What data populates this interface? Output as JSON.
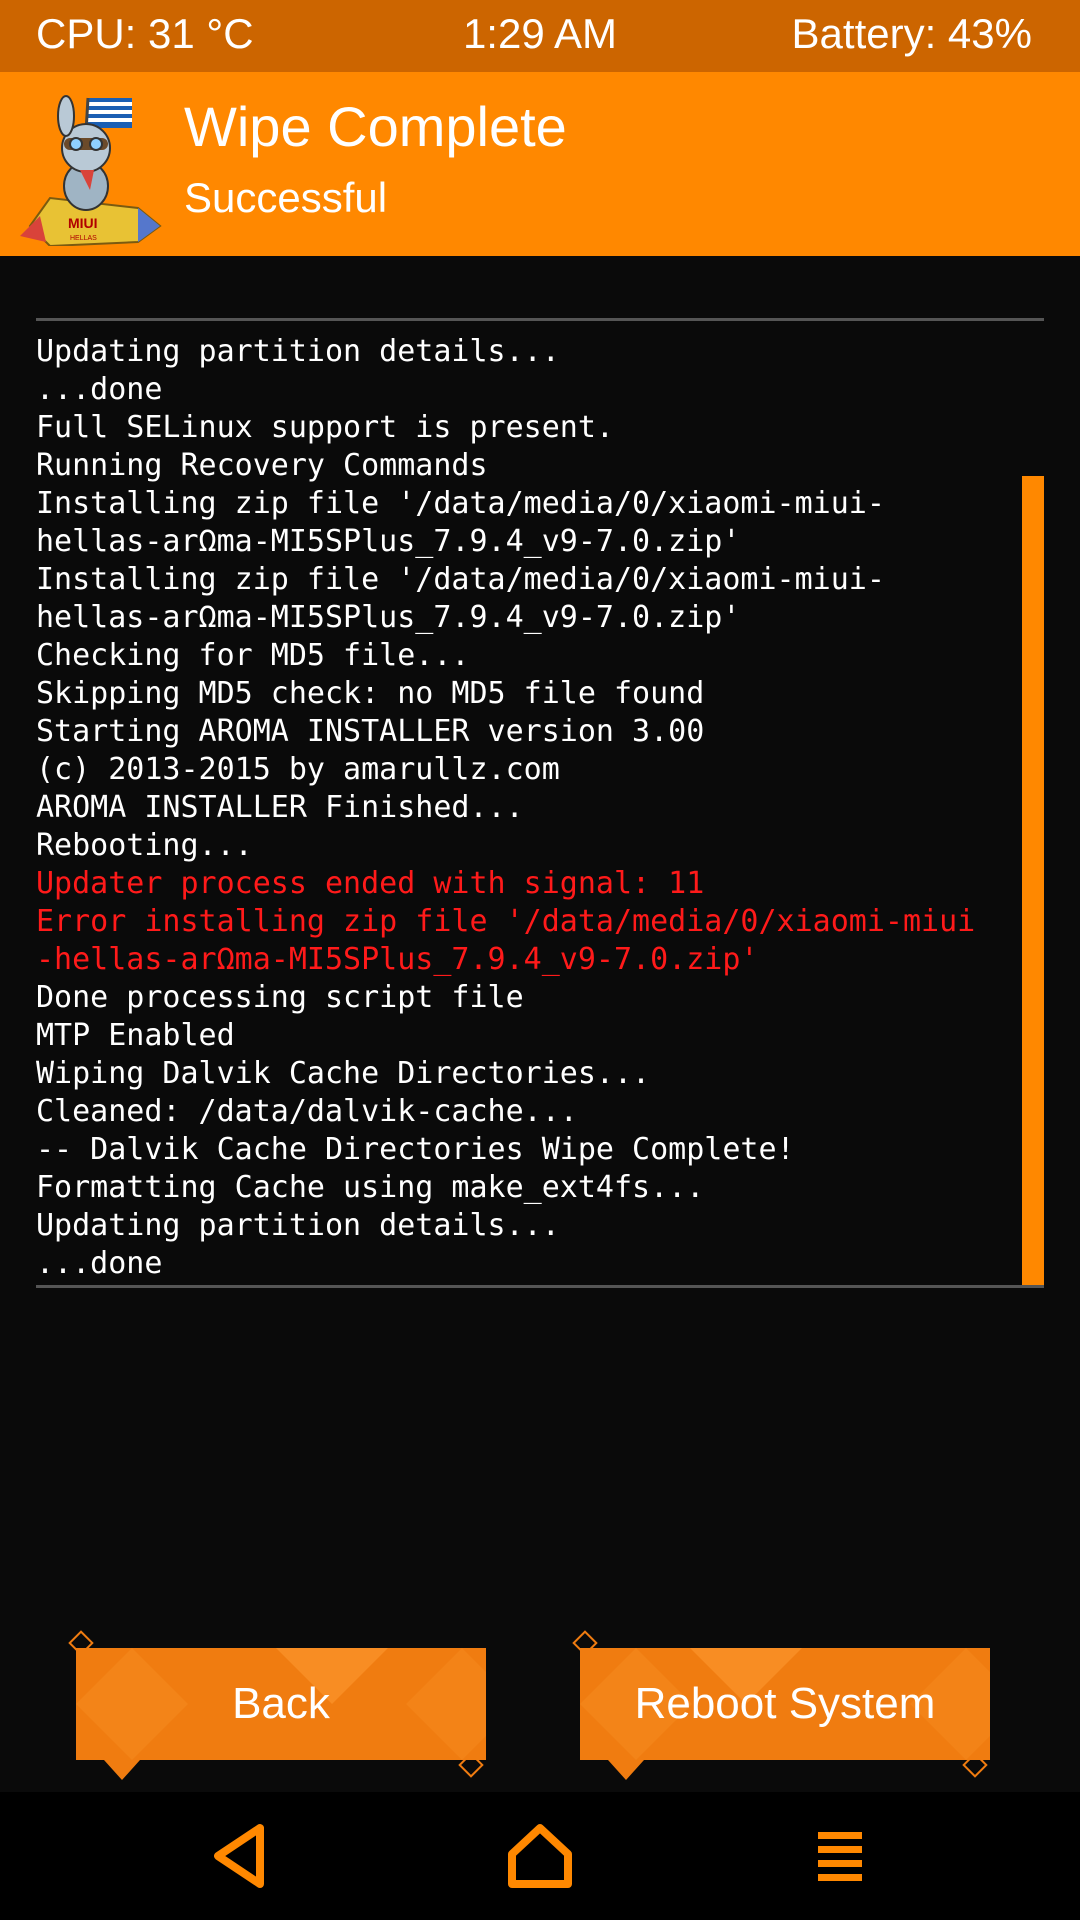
{
  "status_bar": {
    "cpu": "CPU: 31 °C",
    "time": "1:29 AM",
    "battery": "Battery: 43%"
  },
  "header": {
    "title": "Wipe Complete",
    "subtitle": "Successful",
    "logo_text": "MIUI HELLAS"
  },
  "console": {
    "lines": [
      {
        "text": "Updating partition details...",
        "error": false
      },
      {
        "text": "...done",
        "error": false
      },
      {
        "text": "Full SELinux support is present.",
        "error": false
      },
      {
        "text": "Running Recovery Commands",
        "error": false
      },
      {
        "text": "Installing zip file '/data/media/0/xiaomi-miui-",
        "error": false
      },
      {
        "text": "hellas-arΩma-MI5SPlus_7.9.4_v9-7.0.zip'",
        "error": false
      },
      {
        "text": "Installing zip file '/data/media/0/xiaomi-miui-",
        "error": false
      },
      {
        "text": "hellas-arΩma-MI5SPlus_7.9.4_v9-7.0.zip'",
        "error": false
      },
      {
        "text": "Checking for MD5 file...",
        "error": false
      },
      {
        "text": "Skipping MD5 check: no MD5 file found",
        "error": false
      },
      {
        "text": "Starting AROMA INSTALLER version 3.00",
        "error": false
      },
      {
        "text": "(c) 2013-2015 by amarullz.com",
        "error": false
      },
      {
        "text": "AROMA INSTALLER Finished...",
        "error": false
      },
      {
        "text": "Rebooting...",
        "error": false
      },
      {
        "text": "Updater process ended with signal: 11",
        "error": true
      },
      {
        "text": "Error installing zip file '/data/media/0/xiaomi-miui",
        "error": true
      },
      {
        "text": "-hellas-arΩma-MI5SPlus_7.9.4_v9-7.0.zip'",
        "error": true
      },
      {
        "text": "Done processing script file",
        "error": false
      },
      {
        "text": "MTP Enabled",
        "error": false
      },
      {
        "text": "Wiping Dalvik Cache Directories...",
        "error": false
      },
      {
        "text": "Cleaned: /data/dalvik-cache...",
        "error": false
      },
      {
        "text": "-- Dalvik Cache Directories Wipe Complete!",
        "error": false
      },
      {
        "text": "Formatting Cache using make_ext4fs...",
        "error": false
      },
      {
        "text": "Updating partition details...",
        "error": false
      },
      {
        "text": "...done",
        "error": false
      }
    ]
  },
  "buttons": {
    "back": "Back",
    "reboot": "Reboot System"
  },
  "navbar": {
    "icons": [
      "back-icon",
      "home-icon",
      "menu-icon"
    ]
  },
  "colors": {
    "accent": "#ff8800",
    "status_bar": "#cc6500",
    "error_text": "#ff1a1a",
    "button": "#f07c10"
  }
}
